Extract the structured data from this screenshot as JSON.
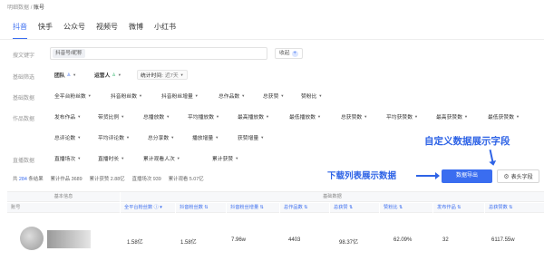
{
  "breadcrumb": {
    "parent": "明细数据",
    "sep": "/",
    "current": "账号"
  },
  "tabs": [
    "抖音",
    "快手",
    "公众号",
    "视频号",
    "微博",
    "小红书"
  ],
  "filters": {
    "search_label": "搜文键字",
    "search_tag": "抖音号/昵称",
    "collect_label": "收起",
    "basic_label": "基础筛选",
    "team_label": "团队",
    "operator_label": "运营人",
    "stat_time_label": "统计时间:",
    "stat_time_value": "近7天",
    "basic_data_label": "基础数据",
    "basic_data_chips": [
      "全平台粉丝数",
      "抖音粉丝数",
      "抖音粉丝增量",
      "总作品数",
      "总获赞",
      "赞粉比"
    ],
    "works_label": "作品数据",
    "works_row1": [
      "发布作品",
      "带货比例",
      "总播放数",
      "平均播放数",
      "最高播放数",
      "最低播放数",
      "总获赞数",
      "平均获赞数",
      "最高获赞数",
      "最低获赞数"
    ],
    "works_row2": [
      "总评论数",
      "平均评论数",
      "总分享数",
      "播放增量",
      "获赞增量"
    ],
    "live_label": "直播数据",
    "live_chips": [
      "直播场次",
      "直播时长",
      "累计观看人次",
      "累计获赞"
    ]
  },
  "stats": {
    "count_prefix": "共",
    "count": "284",
    "count_suffix": "条结果",
    "works_label": "累计作品",
    "works_value": "3689",
    "likes_label": "累计获赞",
    "likes_value": "2.88亿",
    "live_label": "直播场次",
    "live_value": "939",
    "views_label": "累计观看",
    "views_value": "5.07亿"
  },
  "annotations": {
    "custom_fields": "自定义数据展示字段",
    "download": "下载列表展示数据"
  },
  "buttons": {
    "export": "数据导出",
    "fields": "表头字段"
  },
  "table": {
    "group_basic": "基本信息",
    "group_data": "基础数据",
    "headers": [
      "账号",
      "全平台粉丝数 ⓘ ▾",
      "抖音粉丝数 ⇅",
      "抖音粉丝增量 ⇅",
      "总作品数 ⇅",
      "总获赞 ⇅",
      "赞粉比 ⇅",
      "发布作品 ⇅",
      "总获赞数 ⇅"
    ],
    "row": [
      "1.58亿",
      "1.58亿",
      "7.96w",
      "4403",
      "98.37亿",
      "62.09%",
      "32",
      "6117.55w"
    ]
  },
  "colors": {
    "accent": "#3a6df0",
    "annotation": "#2e63e6"
  }
}
